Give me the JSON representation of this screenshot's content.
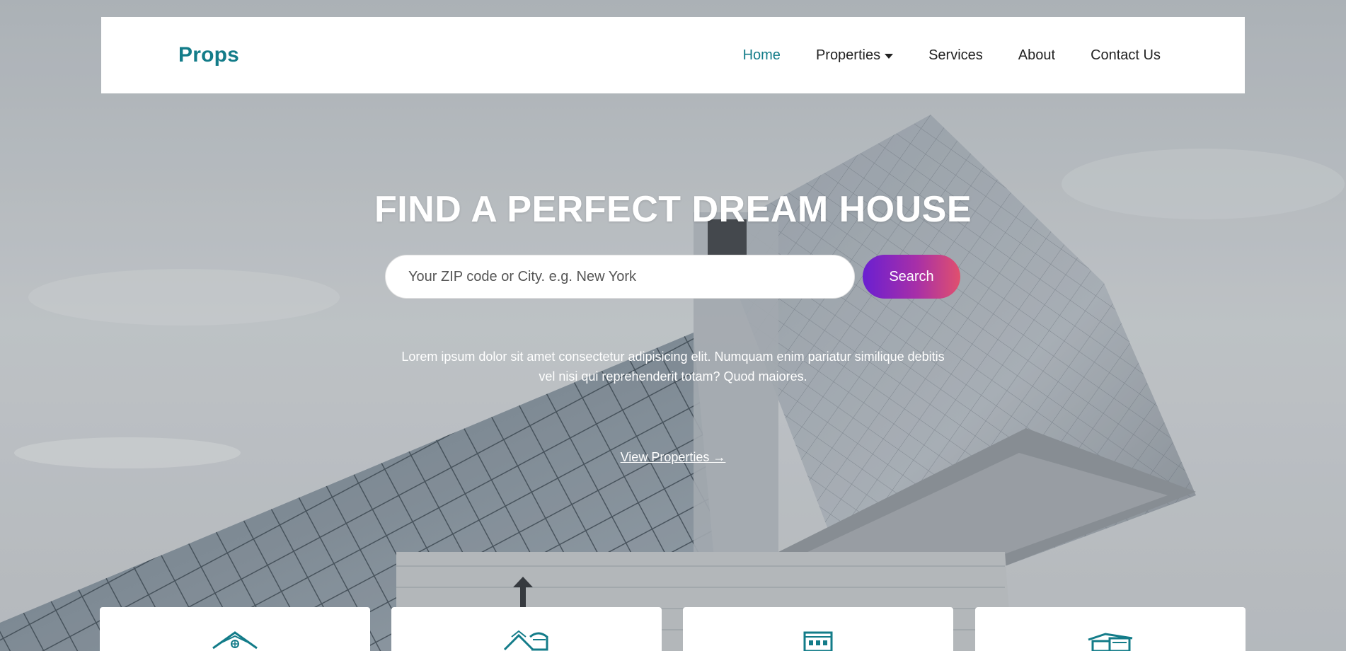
{
  "brand": {
    "name": "Props",
    "color": "#137c89"
  },
  "nav": {
    "items": [
      {
        "label": "Home",
        "active": true
      },
      {
        "label": "Properties",
        "dropdown": true
      },
      {
        "label": "Services"
      },
      {
        "label": "About"
      },
      {
        "label": "Contact Us"
      }
    ]
  },
  "hero": {
    "title": "FIND A PERFECT DREAM HOUSE",
    "search": {
      "placeholder": "Your ZIP code or City. e.g. New York",
      "value": "",
      "button_label": "Search",
      "button_gradient": [
        "#6a1fd1",
        "#e0506e"
      ]
    },
    "description": "Lorem ipsum dolor sit amet consectetur adipisicing elit. Numquam enim pariatur similique debitis vel nisi qui reprehenderit totam? Quod maiores.",
    "cta_label": "View Properties →"
  },
  "cards": [
    {
      "icon": "house-icon"
    },
    {
      "icon": "homes-icon"
    },
    {
      "icon": "building-icon"
    },
    {
      "icon": "office-icon"
    }
  ],
  "colors": {
    "accent": "#137c89",
    "text": "#222222"
  }
}
